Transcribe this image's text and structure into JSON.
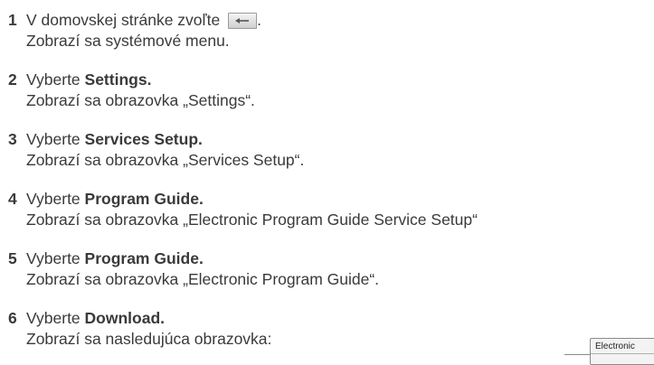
{
  "steps": [
    {
      "number": "1",
      "line1_text": "V domovskej stránke zvoľte",
      "line1_suffix": ".",
      "line2": "Zobrazí sa systémové menu."
    },
    {
      "number": "2",
      "line1_prefix": "Vyberte ",
      "line1_bold": "Settings.",
      "line2": "Zobrazí sa obrazovka „Settings“."
    },
    {
      "number": "3",
      "line1_prefix": "Vyberte ",
      "line1_bold": "Services Setup.",
      "line2": "Zobrazí sa obrazovka „Services Setup“."
    },
    {
      "number": "4",
      "line1_prefix": "Vyberte ",
      "line1_bold": "Program Guide.",
      "line2": "Zobrazí sa obrazovka „Electronic Program Guide Service Setup“"
    },
    {
      "number": "5",
      "line1_prefix": "Vyberte ",
      "line1_bold": "Program Guide.",
      "line2": "Zobrazí sa obrazovka „Electronic Program Guide“."
    },
    {
      "number": "6",
      "line1_prefix": "Vyberte ",
      "line1_bold": "Download.",
      "line2": "Zobrazí sa nasledujúca obrazovka:"
    }
  ],
  "back_button_icon": "back-arrow-icon",
  "callout": {
    "title": "Electronic"
  }
}
